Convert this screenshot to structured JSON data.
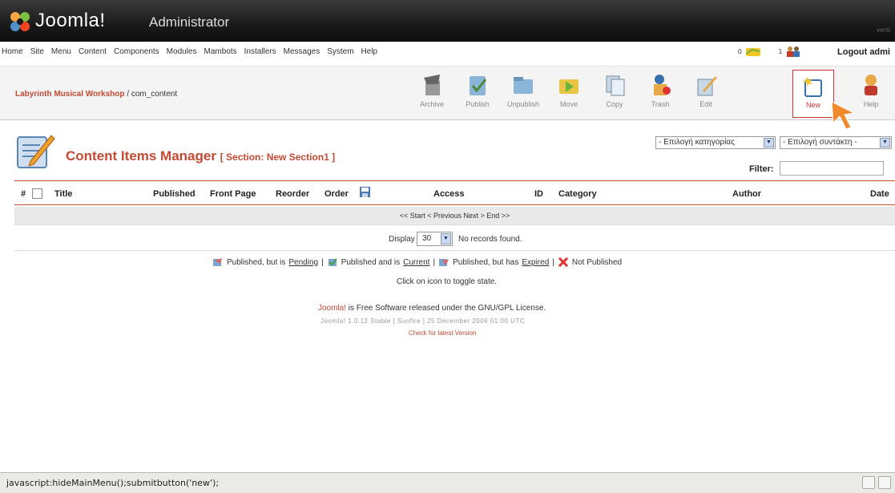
{
  "header": {
    "brand": "Joomla!",
    "subtitle": "Administrator",
    "right_text": "versi"
  },
  "menu": {
    "items": [
      "Home",
      "Site",
      "Menu",
      "Content",
      "Components",
      "Modules",
      "Mambots",
      "Installers",
      "Messages",
      "System",
      "Help"
    ],
    "unread_messages": "0",
    "users_online": "1",
    "logout_label": "Logout admi"
  },
  "toolbar": {
    "site_name": "Labyrinth Musical Workshop",
    "path": " / com_content",
    "buttons": [
      "Archive",
      "Publish",
      "Unpublish",
      "Move",
      "Copy",
      "Trash",
      "Edit",
      "New",
      "Help"
    ]
  },
  "page": {
    "title": "Content Items Manager",
    "section": "[ Section: New Section1 ]",
    "category_select": "- Επιλογή κατηγορίας",
    "author_select": "- Επιλογή συντάκτη -",
    "filter_label": "Filter:",
    "filter_value": ""
  },
  "table": {
    "columns": [
      "#",
      "Title",
      "Published",
      "Front Page",
      "Reorder",
      "Order",
      "Access",
      "ID",
      "Category",
      "Author",
      "Date"
    ],
    "pagination": "<< Start < Previous Next > End >>",
    "display_label": "Display #",
    "display_value": "30",
    "no_records": "No records found."
  },
  "legend": {
    "pending_prefix": "Published, but is",
    "pending": "Pending",
    "current_prefix": "Published and is",
    "current": "Current",
    "expired_prefix": "Published, but has",
    "expired": "Expired",
    "not_published": "Not Published",
    "hint": "Click on icon to toggle state."
  },
  "footer": {
    "brand": "Joomla!",
    "license": " is Free Software released under the GNU/GPL License.",
    "version": "Joomla! 1.0.12 Stable [ Sunfire ] 25 December 2006 01:00 UTC",
    "check": "Check for latest Version"
  },
  "statusbar": {
    "text": "javascript:hideMainMenu();submitbutton('new');"
  },
  "colors": {
    "accent": "#c64934",
    "header": "#1a1a1a"
  }
}
